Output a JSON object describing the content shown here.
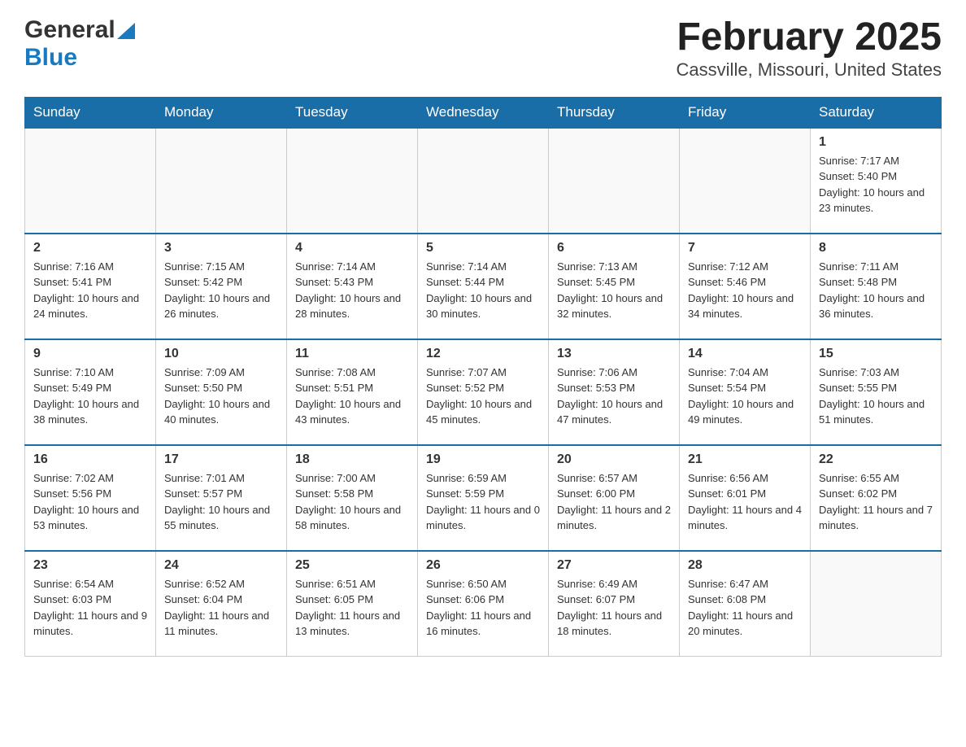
{
  "logo": {
    "text_general": "General",
    "text_blue": "Blue"
  },
  "title": "February 2025",
  "subtitle": "Cassville, Missouri, United States",
  "weekdays": [
    "Sunday",
    "Monday",
    "Tuesday",
    "Wednesday",
    "Thursday",
    "Friday",
    "Saturday"
  ],
  "weeks": [
    [
      {
        "day": "",
        "info": ""
      },
      {
        "day": "",
        "info": ""
      },
      {
        "day": "",
        "info": ""
      },
      {
        "day": "",
        "info": ""
      },
      {
        "day": "",
        "info": ""
      },
      {
        "day": "",
        "info": ""
      },
      {
        "day": "1",
        "info": "Sunrise: 7:17 AM\nSunset: 5:40 PM\nDaylight: 10 hours and 23 minutes."
      }
    ],
    [
      {
        "day": "2",
        "info": "Sunrise: 7:16 AM\nSunset: 5:41 PM\nDaylight: 10 hours and 24 minutes."
      },
      {
        "day": "3",
        "info": "Sunrise: 7:15 AM\nSunset: 5:42 PM\nDaylight: 10 hours and 26 minutes."
      },
      {
        "day": "4",
        "info": "Sunrise: 7:14 AM\nSunset: 5:43 PM\nDaylight: 10 hours and 28 minutes."
      },
      {
        "day": "5",
        "info": "Sunrise: 7:14 AM\nSunset: 5:44 PM\nDaylight: 10 hours and 30 minutes."
      },
      {
        "day": "6",
        "info": "Sunrise: 7:13 AM\nSunset: 5:45 PM\nDaylight: 10 hours and 32 minutes."
      },
      {
        "day": "7",
        "info": "Sunrise: 7:12 AM\nSunset: 5:46 PM\nDaylight: 10 hours and 34 minutes."
      },
      {
        "day": "8",
        "info": "Sunrise: 7:11 AM\nSunset: 5:48 PM\nDaylight: 10 hours and 36 minutes."
      }
    ],
    [
      {
        "day": "9",
        "info": "Sunrise: 7:10 AM\nSunset: 5:49 PM\nDaylight: 10 hours and 38 minutes."
      },
      {
        "day": "10",
        "info": "Sunrise: 7:09 AM\nSunset: 5:50 PM\nDaylight: 10 hours and 40 minutes."
      },
      {
        "day": "11",
        "info": "Sunrise: 7:08 AM\nSunset: 5:51 PM\nDaylight: 10 hours and 43 minutes."
      },
      {
        "day": "12",
        "info": "Sunrise: 7:07 AM\nSunset: 5:52 PM\nDaylight: 10 hours and 45 minutes."
      },
      {
        "day": "13",
        "info": "Sunrise: 7:06 AM\nSunset: 5:53 PM\nDaylight: 10 hours and 47 minutes."
      },
      {
        "day": "14",
        "info": "Sunrise: 7:04 AM\nSunset: 5:54 PM\nDaylight: 10 hours and 49 minutes."
      },
      {
        "day": "15",
        "info": "Sunrise: 7:03 AM\nSunset: 5:55 PM\nDaylight: 10 hours and 51 minutes."
      }
    ],
    [
      {
        "day": "16",
        "info": "Sunrise: 7:02 AM\nSunset: 5:56 PM\nDaylight: 10 hours and 53 minutes."
      },
      {
        "day": "17",
        "info": "Sunrise: 7:01 AM\nSunset: 5:57 PM\nDaylight: 10 hours and 55 minutes."
      },
      {
        "day": "18",
        "info": "Sunrise: 7:00 AM\nSunset: 5:58 PM\nDaylight: 10 hours and 58 minutes."
      },
      {
        "day": "19",
        "info": "Sunrise: 6:59 AM\nSunset: 5:59 PM\nDaylight: 11 hours and 0 minutes."
      },
      {
        "day": "20",
        "info": "Sunrise: 6:57 AM\nSunset: 6:00 PM\nDaylight: 11 hours and 2 minutes."
      },
      {
        "day": "21",
        "info": "Sunrise: 6:56 AM\nSunset: 6:01 PM\nDaylight: 11 hours and 4 minutes."
      },
      {
        "day": "22",
        "info": "Sunrise: 6:55 AM\nSunset: 6:02 PM\nDaylight: 11 hours and 7 minutes."
      }
    ],
    [
      {
        "day": "23",
        "info": "Sunrise: 6:54 AM\nSunset: 6:03 PM\nDaylight: 11 hours and 9 minutes."
      },
      {
        "day": "24",
        "info": "Sunrise: 6:52 AM\nSunset: 6:04 PM\nDaylight: 11 hours and 11 minutes."
      },
      {
        "day": "25",
        "info": "Sunrise: 6:51 AM\nSunset: 6:05 PM\nDaylight: 11 hours and 13 minutes."
      },
      {
        "day": "26",
        "info": "Sunrise: 6:50 AM\nSunset: 6:06 PM\nDaylight: 11 hours and 16 minutes."
      },
      {
        "day": "27",
        "info": "Sunrise: 6:49 AM\nSunset: 6:07 PM\nDaylight: 11 hours and 18 minutes."
      },
      {
        "day": "28",
        "info": "Sunrise: 6:47 AM\nSunset: 6:08 PM\nDaylight: 11 hours and 20 minutes."
      },
      {
        "day": "",
        "info": ""
      }
    ]
  ]
}
